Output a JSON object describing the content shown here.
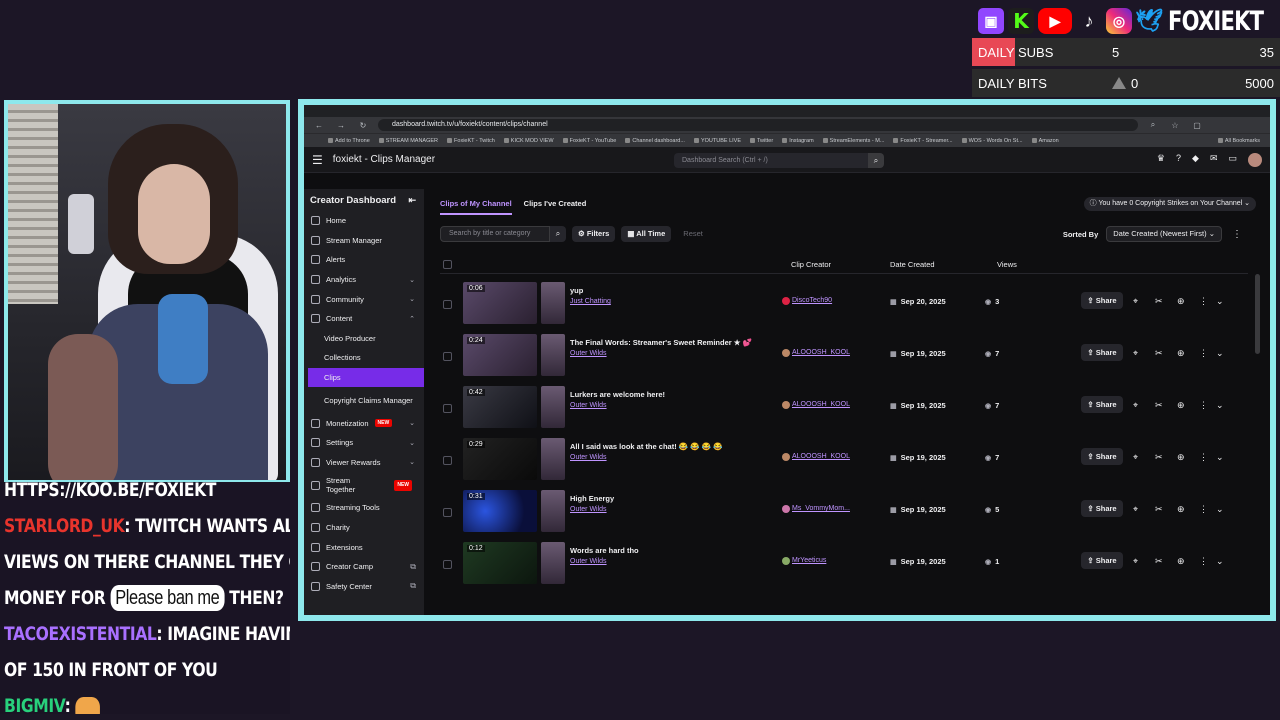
{
  "overlay": {
    "brand": "FOXIEKT",
    "socials": [
      "twitch-icon",
      "kick-icon",
      "youtube-icon",
      "tiktok-icon",
      "instagram-icon",
      "twitter-icon"
    ],
    "goals": [
      {
        "label": "DAILY SUBS",
        "current": "5",
        "max": "35",
        "progress": 0.14
      },
      {
        "label": "DAILY BITS",
        "current": "0",
        "max": "5000",
        "progress": 0
      }
    ]
  },
  "chat": [
    {
      "user": "",
      "text": "HTTPS://KOO.BE/FOXIEKT"
    },
    {
      "user": "STARLORD_UK",
      "color": "#e8342c",
      "text": ": TWITCH WANTS ALL THE"
    },
    {
      "user": "",
      "text": "VIEWS ON THERE CHANNEL THEY GET THE"
    },
    {
      "user": "",
      "text": "MONEY FOR",
      "pill": "Please ban me",
      "after": "THEN?"
    },
    {
      "user": "TACOEXISTENTIAL",
      "color": "#a970ff",
      "text": ": IMAGINE HAVING A GROUP"
    },
    {
      "user": "",
      "text": "OF 150 IN FRONT OF YOU"
    },
    {
      "user": "BIGMIV",
      "color": "#28d17c",
      "text": ":"
    }
  ],
  "browser": {
    "url": "dashboard.twitch.tv/u/foxiekt/content/clips/channel",
    "bookmarks": [
      "Add to Throne",
      "STREAM MANAGER",
      "FoxieKT - Twitch",
      "KICK MOD VIEW",
      "FoxieKT - YouTube",
      "Channel dashboard...",
      "YOUTUBE LIVE",
      "Twitter",
      "Instagram",
      "StreamElements - M...",
      "FoxieKT - Streamer...",
      "WOS - Words On St...",
      "Amazon"
    ],
    "all_bookmarks": "All Bookmarks"
  },
  "twitch": {
    "title": "foxiekt - Clips Manager",
    "search_placeholder": "Dashboard Search (Ctrl + /)",
    "sidebar_title": "Creator Dashboard",
    "sidebar": [
      {
        "label": "Home"
      },
      {
        "label": "Stream Manager"
      },
      {
        "label": "Alerts"
      },
      {
        "label": "Analytics",
        "chevron": "⌄"
      },
      {
        "label": "Community",
        "chevron": "⌄"
      },
      {
        "label": "Content",
        "chevron": "⌃"
      },
      {
        "label": "Video Producer",
        "sub": true
      },
      {
        "label": "Collections",
        "sub": true
      },
      {
        "label": "Clips",
        "sub": true,
        "active": true
      },
      {
        "label": "Copyright Claims Manager",
        "sub": true,
        "two": true
      },
      {
        "label": "Monetization",
        "new": "NEW",
        "chevron": "⌄"
      },
      {
        "label": "Settings",
        "chevron": "⌄"
      },
      {
        "label": "Viewer Rewards",
        "chevron": "⌄"
      },
      {
        "label": "Stream Together",
        "new": "NEW",
        "two": true
      },
      {
        "label": "Streaming Tools"
      },
      {
        "label": "Charity"
      },
      {
        "label": "Extensions"
      },
      {
        "label": "Creator Camp",
        "ext": true
      },
      {
        "label": "Safety Center",
        "ext": true
      }
    ],
    "tabs": [
      "Clips of My Channel",
      "Clips I've Created"
    ],
    "strikes": "You have 0 Copyright Strikes on Your Channel",
    "filter_placeholder": "Search by title or category",
    "filters_label": "Filters",
    "alltime_label": "All Time",
    "reset_label": "Reset",
    "sorted_by": "Sorted By",
    "sort_value": "Date Created (Newest First)",
    "columns": {
      "creator": "Clip Creator",
      "date": "Date Created",
      "views": "Views"
    },
    "share_label": "Share",
    "clips": [
      {
        "duration": "0:06",
        "title": "yup",
        "category": "Just Chatting",
        "creator": "DiscoTech90",
        "date": "Sep 20, 2025",
        "views": "3",
        "thumb": ""
      },
      {
        "duration": "0:24",
        "title": "The Final Words: Streamer's Sweet Reminder ★ 💕",
        "category": "Outer Wilds",
        "creator": "ALOOOSH_KOOL",
        "date": "Sep 19, 2025",
        "views": "7",
        "thumb": ""
      },
      {
        "duration": "0:42",
        "title": "Lurkers are welcome here!",
        "category": "Outer Wilds",
        "creator": "ALOOOSH_KOOL",
        "date": "Sep 19, 2025",
        "views": "7",
        "thumb": "sky"
      },
      {
        "duration": "0:29",
        "title": "All I said was look at the chat! 😂 😂 😂 😂",
        "category": "Outer Wilds",
        "creator": "ALOOOSH_KOOL",
        "date": "Sep 19, 2025",
        "views": "7",
        "thumb": "dark"
      },
      {
        "duration": "0:31",
        "title": "High Energy",
        "category": "Outer Wilds",
        "creator": "Ms_VommyMom...",
        "date": "Sep 19, 2025",
        "views": "5",
        "thumb": "space"
      },
      {
        "duration": "0:12",
        "title": "Words are hard tho",
        "category": "Outer Wilds",
        "creator": "MrYeeticus",
        "date": "Sep 19, 2025",
        "views": "1",
        "thumb": "green"
      }
    ]
  }
}
